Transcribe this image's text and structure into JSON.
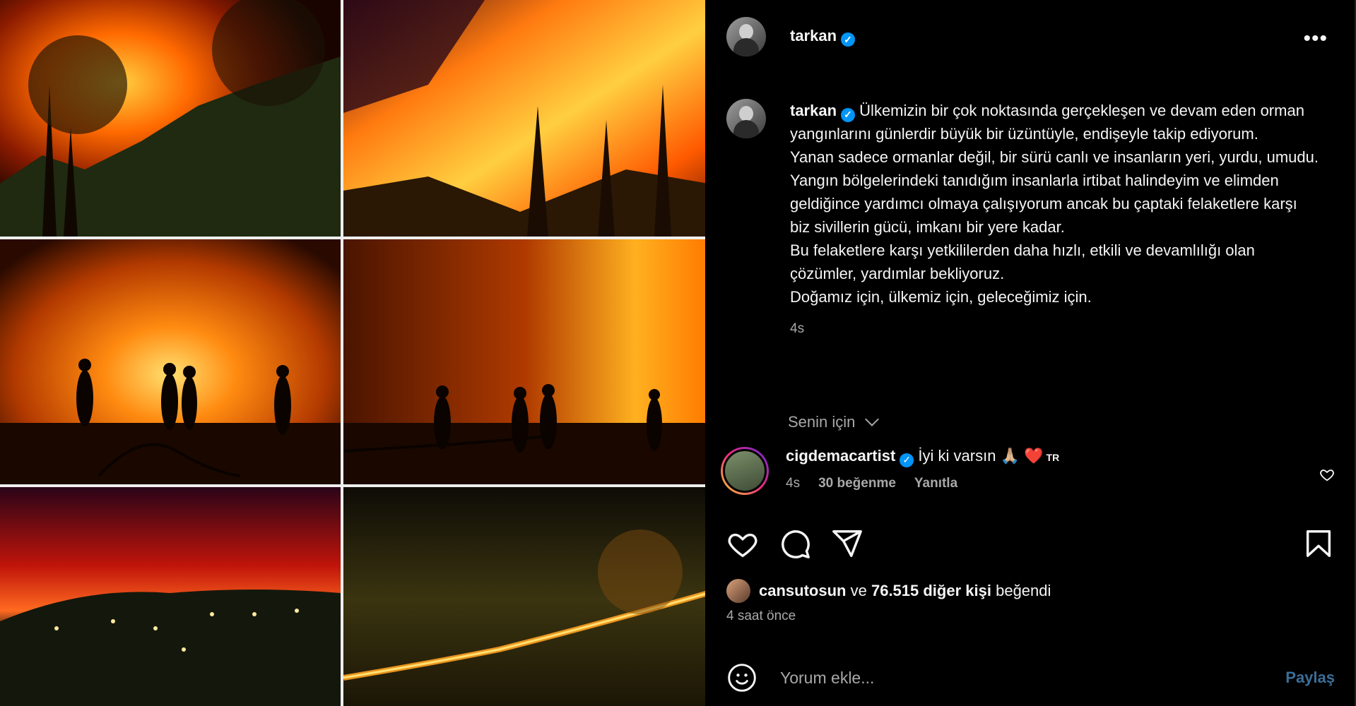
{
  "post": {
    "username": "tarkan",
    "more_label": "•••"
  },
  "caption": {
    "author": "tarkan",
    "lines": [
      "Ülkemizin bir çok noktasında gerçekleşen ve devam eden orman yangınlarını günlerdir büyük bir üzüntüyle, endişeyle takip ediyorum.",
      "Yanan sadece ormanlar değil, bir sürü canlı ve insanların yeri, yurdu, umudu.",
      "Yangın bölgelerindeki tanıdığım insanlarla irtibat halindeyim ve elimden geldiğince yardımcı olmaya çalışıyorum ancak bu çaptaki felaketlere karşı biz sivillerin gücü, imkanı bir yere kadar.",
      "Bu felaketlere karşı yetkililerden daha hızlı, etkili ve devamlılığı olan çözümler, yardımlar bekliyoruz.",
      "Doğamız için, ülkemiz için, geleceğimiz için."
    ],
    "time": "4s"
  },
  "filter_label": "Senin için",
  "comment": {
    "user": "cigdemacartist",
    "text": "İyi ki varsın",
    "emoji_praying": "🙏🏼",
    "emoji_heart": "❤️",
    "flag": "TR",
    "time": "4s",
    "likes": "30 beğenme",
    "reply": "Yanıtla"
  },
  "icons": {
    "like": "heart-icon",
    "comment": "comment-icon",
    "share": "share-icon",
    "save": "bookmark-icon",
    "emoji": "emoji-icon"
  },
  "likes": {
    "first_user": "cansutosun",
    "connector": "ve",
    "count_text": "76.515 diğer kişi",
    "suffix": "beğendi"
  },
  "posted_ago": "4 saat önce",
  "add_comment": {
    "placeholder": "Yorum ekle...",
    "post_label": "Paylaş"
  },
  "colors": {
    "accent_blue": "#0095f6",
    "post_button_disabled": "#3b6e98",
    "secondary_text": "#a8a8a8"
  }
}
